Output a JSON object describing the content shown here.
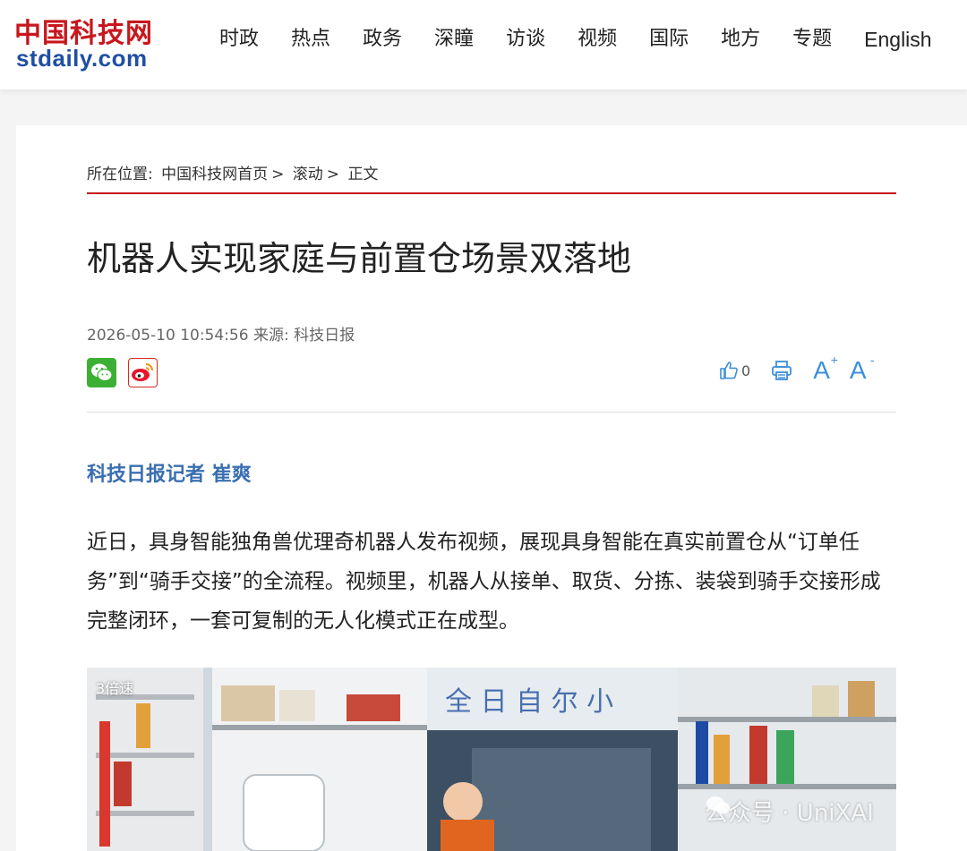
{
  "header": {
    "logo_cn": "中国科技网",
    "logo_en": "stdaily.com",
    "nav": [
      "时政",
      "热点",
      "政务",
      "深瞳",
      "访谈",
      "视频",
      "国际",
      "地方",
      "专题",
      "English"
    ]
  },
  "breadcrumb": {
    "prefix": "所在位置:",
    "home": "中国科技网首页",
    "sep1": ">",
    "section": "滚动",
    "sep2": ">",
    "current": "正文"
  },
  "article": {
    "title": "机器人实现家庭与前置仓场景双落地",
    "meta": "2026-05-10 10:54:56 来源: 科技日报",
    "author": "科技日报记者 崔爽",
    "paragraph": "近日，具身智能独角兽优理奇机器人发布视频，展现具身智能在真实前置仓从“订单任务”到“骑手交接”的全流程。视频里，机器人从接单、取货、分拣、装袋到骑手交接形成完整闭环，一套可复制的无人化模式正在成型。"
  },
  "toolbar": {
    "like_count": "0",
    "icons": [
      "thumbs-up-icon",
      "print-icon",
      "font-increase-icon",
      "font-decrease-icon"
    ],
    "font_plus": "A",
    "font_minus": "A",
    "plus_sign": "+",
    "minus_sign": "-"
  },
  "share": {
    "icons": [
      "wechat-icon",
      "weibo-icon"
    ]
  },
  "photo": {
    "speed_label": "3倍速",
    "watermark": "公众号 · UniXAI"
  },
  "colors": {
    "brand_red": "#c8161d",
    "brand_blue": "#1f4fa3",
    "link_blue": "#3d8fd8",
    "author_blue": "#3a6fb0"
  }
}
